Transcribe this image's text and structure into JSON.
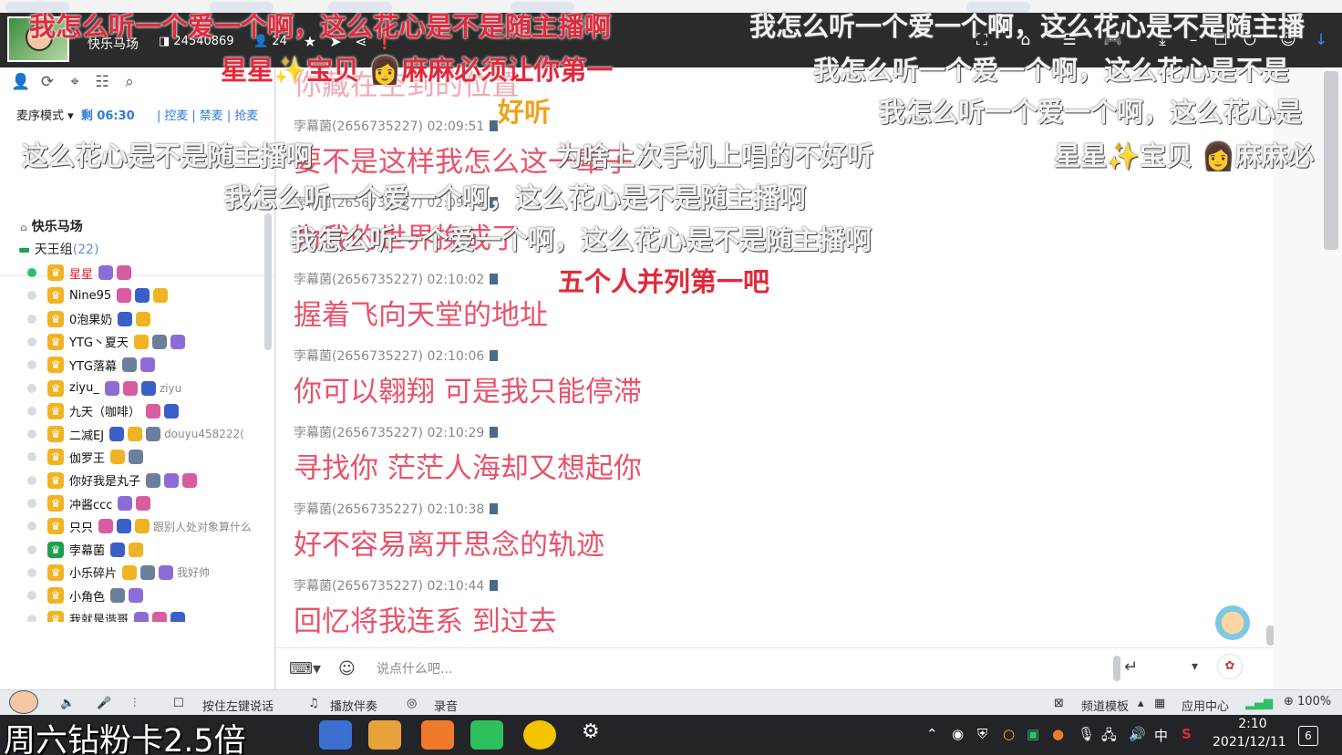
{
  "room": {
    "name": "快乐马场",
    "id": "24540869",
    "online": "24"
  },
  "left": {
    "mic_mode": "麦序模式",
    "mic_remaining": "剩 06:30",
    "mic_actions": [
      "控麦",
      "禁麦",
      "抢麦"
    ],
    "tree_root": "快乐马场",
    "group_name": "天王组",
    "group_count": "(22)",
    "members": [
      {
        "nick": "星星",
        "highlight": true,
        "online": true,
        "sig": ""
      },
      {
        "nick": "Nine95",
        "sig": ""
      },
      {
        "nick": "0泡果奶",
        "sig": ""
      },
      {
        "nick": "YTG丶夏天",
        "sig": ""
      },
      {
        "nick": "YTG落幕",
        "sig": ""
      },
      {
        "nick": "ziyu_",
        "sig": "ziyu"
      },
      {
        "nick": "九天（咖啡）",
        "sig": ""
      },
      {
        "nick": "二减EJ",
        "sig": "douyu458222("
      },
      {
        "nick": "伽罗王",
        "sig": ""
      },
      {
        "nick": "你好我是丸子",
        "sig": ""
      },
      {
        "nick": "冲酱ccc",
        "sig": ""
      },
      {
        "nick": "只只",
        "sig": "跟别人处对象算什么"
      },
      {
        "nick": "孛幕菌",
        "sig": ""
      },
      {
        "nick": "小乐碎片",
        "sig": "我好帅"
      },
      {
        "nick": "小角色",
        "sig": ""
      },
      {
        "nick": "我就是谐哥",
        "sig": ""
      }
    ]
  },
  "chat": {
    "messages": [
      {
        "sender": "孛幕菌(2656735227)",
        "time": "02:09:51",
        "text": "要不是这样我怎么这一辈子"
      },
      {
        "sender": "孛幕菌(2656735227)",
        "time": "02:09:58",
        "text": "为我的世界换成了"
      },
      {
        "sender": "孛幕菌(2656735227)",
        "time": "02:10:02",
        "text": "握着飞向天堂的地址"
      },
      {
        "sender": "孛幕菌(2656735227)",
        "time": "02:10:06",
        "text": "你可以翱翔  可是我只能停滞"
      },
      {
        "sender": "孛幕菌(2656735227)",
        "time": "02:10:29",
        "text": "寻找你  茫茫人海却又想起你"
      },
      {
        "sender": "孛幕菌(2656735227)",
        "time": "02:10:38",
        "text": "好不容易离开思念的轨迹"
      },
      {
        "sender": "孛幕菌(2656735227)",
        "time": "02:10:44",
        "text": "回忆将我连系  到过去"
      }
    ],
    "top_partial": "你藏在空到的位置",
    "input_placeholder": "说点什么吧..."
  },
  "bottom": {
    "push_to_talk": "按住左键说话",
    "play_music": "播放伴奏",
    "record": "录音",
    "channel_template": "频道模板",
    "app_center": "应用中心",
    "zoom": "100%"
  },
  "taskbar": {
    "time": "2:10",
    "date": "2021/12/11",
    "notifications": "6",
    "ime": "中"
  },
  "danmaku": {
    "d1": "我怎么听一个爱一个啊，这么花心是不是随主播啊",
    "d2": "我怎么听一个爱一个啊，这么花心是不是随主播",
    "d3": "星星✨宝贝",
    "d4": "麻麻必须让你第一",
    "d5": "我怎么听一个爱一个啊，这么花心是不是",
    "d6": "好听",
    "d7": "我怎么听一个爱一个啊，这么花心是",
    "d8": "这么花心是不是随主播啊",
    "d9": "为啥上次手机上唱的不好听",
    "d10": "星星✨宝贝",
    "d11": "麻麻必",
    "d12": "我怎么听一个爱一个啊，这么花心是不是随主播啊",
    "d13": "我怎么听一个爱一个啊，这么花心是不是随主播啊",
    "d14": "五个人并列第一吧",
    "promo": "周六钻粉卡2.5倍"
  }
}
